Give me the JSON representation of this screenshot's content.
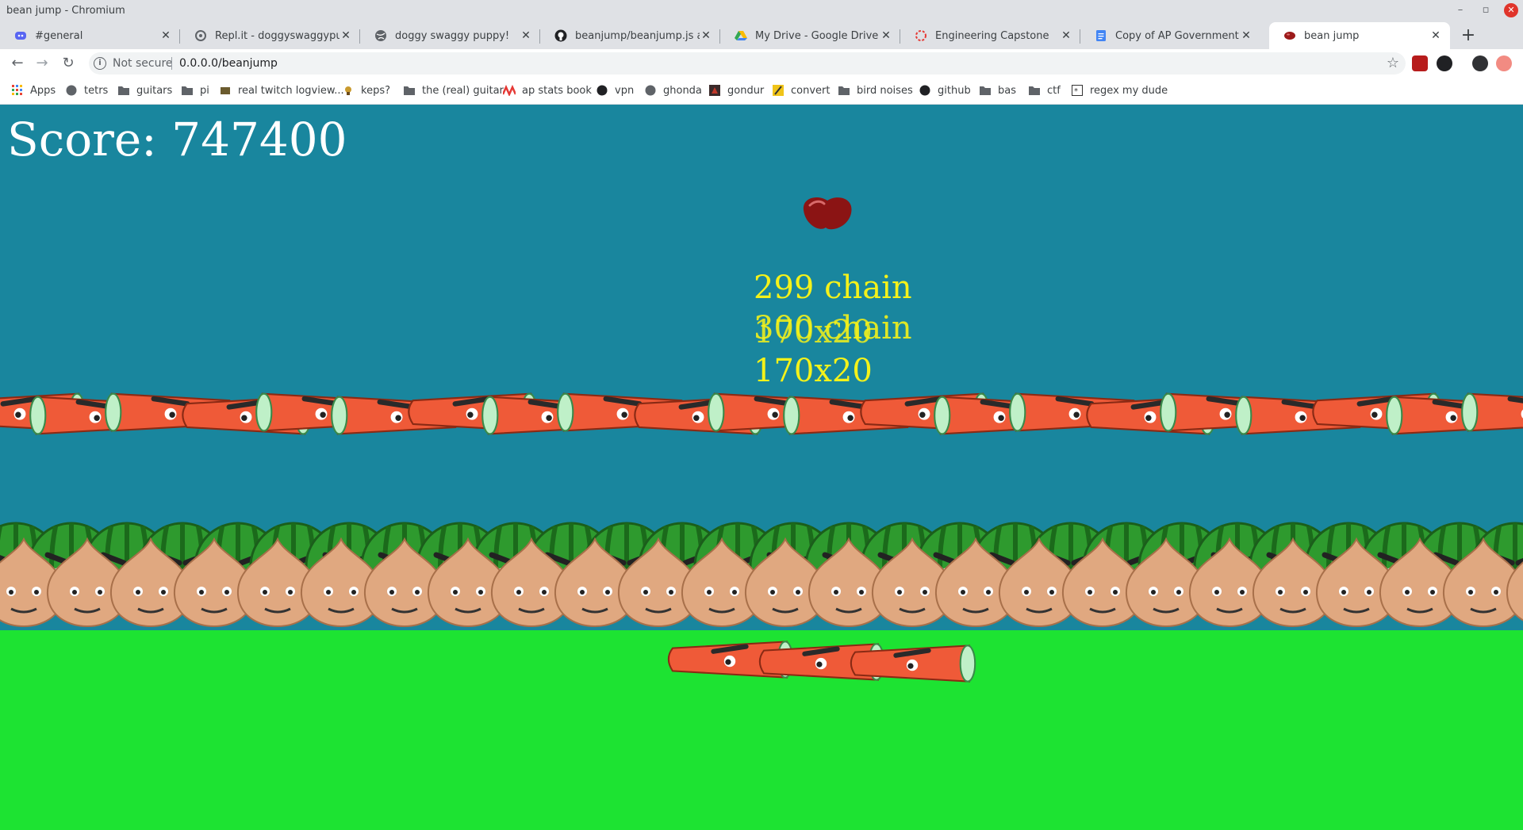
{
  "window": {
    "title": "bean jump - Chromium"
  },
  "tabs": [
    {
      "label": "#general",
      "icon": "discord-icon"
    },
    {
      "label": "Repl.it - doggyswaggypuppy",
      "icon": "replit-icon"
    },
    {
      "label": "doggy swaggy puppy!",
      "icon": "globe-icon"
    },
    {
      "label": "beanjump/beanjump.js at m",
      "icon": "github-icon"
    },
    {
      "label": "My Drive - Google Drive",
      "icon": "google-drive-icon"
    },
    {
      "label": "Engineering Capstone",
      "icon": "loading-icon"
    },
    {
      "label": "Copy of AP Government Mid",
      "icon": "google-docs-icon"
    },
    {
      "label": "bean jump",
      "icon": "bean-icon",
      "active": true
    }
  ],
  "address": {
    "security": "Not secure",
    "url": "0.0.0.0/beanjump"
  },
  "bookmarks": [
    {
      "label": "Apps",
      "icon": "apps-grid-icon"
    },
    {
      "label": "tetrs",
      "icon": "globe-icon"
    },
    {
      "label": "guitars",
      "icon": "folder-icon"
    },
    {
      "label": "pi",
      "icon": "folder-icon"
    },
    {
      "label": "real twitch logview...",
      "icon": "bookmark-icon"
    },
    {
      "label": "keps?",
      "icon": "bookmark-icon"
    },
    {
      "label": "the (real) guitar",
      "icon": "folder-icon"
    },
    {
      "label": "ap stats book",
      "icon": "bookmark-icon"
    },
    {
      "label": "vpn",
      "icon": "github-icon"
    },
    {
      "label": "ghonda",
      "icon": "globe-icon"
    },
    {
      "label": "gondur",
      "icon": "bookmark-icon"
    },
    {
      "label": "convert",
      "icon": "bookmark-icon"
    },
    {
      "label": "bird noises",
      "icon": "folder-icon"
    },
    {
      "label": "github",
      "icon": "github-icon"
    },
    {
      "label": "bas",
      "icon": "folder-icon"
    },
    {
      "label": "ctf",
      "icon": "folder-icon"
    },
    {
      "label": "regex my dude",
      "icon": "bookmark-icon"
    }
  ],
  "game": {
    "score_text": "Score: 747400",
    "popups": [
      "299 chain",
      "300 chain",
      "170x20",
      "170x20"
    ],
    "colors": {
      "sky": "#19869e",
      "ground": "#1de332",
      "score": "#ffffff",
      "popup": "#f4f21a"
    }
  }
}
